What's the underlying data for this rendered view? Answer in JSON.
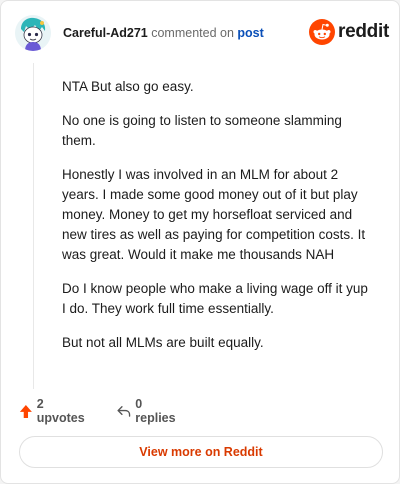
{
  "header": {
    "username": "Careful-Ad271",
    "commented_on": "commented on",
    "post_link": "post",
    "logo_text": "reddit"
  },
  "comment": {
    "paragraphs": [
      "NTA But also go easy.",
      "No one is going to listen to someone slamming them.",
      "Honestly I was involved in an MLM for about 2 years. I made some good money out of it but play money. Money to get my horsefloat serviced and new tires as well as paying for competition costs. It was great. Would it make me thousands NAH",
      "Do I know people who make a living wage off it yup I do. They work full time essentially.",
      "But not all MLMs are built equally."
    ]
  },
  "actions": {
    "upvotes": "2 upvotes",
    "replies": "0 replies"
  },
  "footer": {
    "view_more": "View more on Reddit"
  },
  "colors": {
    "reddit_orange": "#ff4500",
    "upvote_orange": "#ff4500",
    "link_blue": "#0a4fb8",
    "cta_text": "#d93a00"
  },
  "icons": {
    "avatar": "snoo-avatar-icon",
    "logo": "reddit-logo-icon",
    "upvote": "upvote-arrow-icon",
    "reply": "reply-arrow-icon"
  }
}
